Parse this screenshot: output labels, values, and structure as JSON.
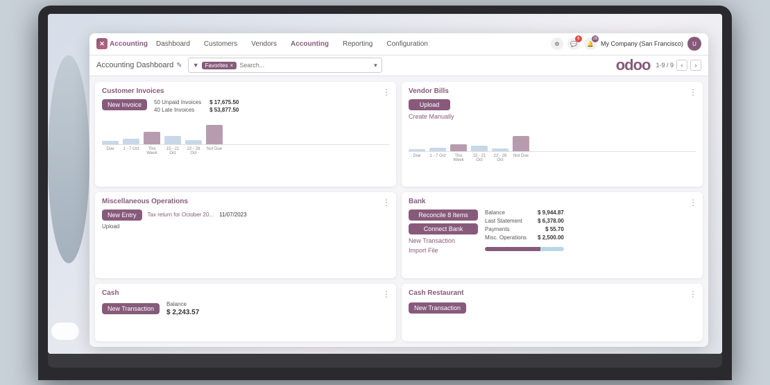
{
  "laptop": {
    "screen_bg": "#f0eff4"
  },
  "topbar": {
    "logo_text": "Accounting",
    "nav_items": [
      {
        "label": "Dashboard",
        "active": false
      },
      {
        "label": "Customers",
        "active": false
      },
      {
        "label": "Vendors",
        "active": false
      },
      {
        "label": "Accounting",
        "active": true
      },
      {
        "label": "Reporting",
        "active": false
      },
      {
        "label": "Configuration",
        "active": false
      }
    ],
    "notification_count_1": "6",
    "notification_count_2": "28",
    "company": "My Company (San Francisco)"
  },
  "toolbar": {
    "title": "Accounting Dashboard",
    "edit_icon": "✎",
    "search_filter": "Favorites",
    "search_placeholder": "Search...",
    "pagination": "1-9 / 9"
  },
  "customer_invoices": {
    "title": "Customer Invoices",
    "new_invoice_label": "New Invoice",
    "unpaid_count": "50 Unpaid Invoices",
    "late_count": "40 Late Invoices",
    "unpaid_amount": "$ 17,675.50",
    "late_amount": "$ 53,877.50",
    "chart_labels": [
      "Due",
      "1 - 7 Oct",
      "This Week",
      "15 - 21 Oct",
      "22 - 28 Oct",
      "Not Due"
    ],
    "chart_bars": [
      5,
      8,
      18,
      12,
      6,
      28
    ]
  },
  "vendor_bills": {
    "title": "Vendor Bills",
    "upload_label": "Upload",
    "create_manually_label": "Create Manually",
    "chart_labels": [
      "Due",
      "1 - 7 Oct",
      "This Week",
      "15 - 21 Oct",
      "22 - 28 Oct",
      "Not Due"
    ],
    "chart_bars": [
      3,
      5,
      10,
      8,
      4,
      22
    ]
  },
  "misc_operations": {
    "title": "Miscellaneous Operations",
    "new_entry_label": "New Entry",
    "upload_label": "Upload",
    "tax_return_label": "Tax return for October 20...",
    "date": "11/07/2023"
  },
  "bank": {
    "title": "Bank",
    "reconcile_label": "Reconcile 8 Items",
    "connect_bank_label": "Connect Bank",
    "new_transaction_label": "New Transaction",
    "import_file_label": "Import File",
    "balance_label": "Balance",
    "last_statement_label": "Last Statement",
    "payments_label": "Payments",
    "misc_operations_label": "Misc. Operations",
    "balance_amount": "$ 9,944.87",
    "last_statement_amount": "$ 6,378.00",
    "payments_amount": "$ 55.70",
    "misc_operations_amount": "$ 2,500.00"
  },
  "cash": {
    "title": "Cash",
    "new_transaction_label": "New Transaction",
    "balance_label": "Balance",
    "balance_amount": "$ 2,243.57"
  },
  "cash_restaurant": {
    "title": "Cash Restaurant",
    "new_transaction_label": "New Transaction"
  },
  "icons": {
    "menu_dots": "⋮",
    "chevron_left": "‹",
    "chevron_right": "›",
    "filter_icon": "▼",
    "search_icon": "🔍",
    "bell_icon": "🔔",
    "chat_icon": "💬",
    "settings_icon": "⚙"
  },
  "colors": {
    "brand_purple": "#875a7b",
    "accent_teal": "#5bc0de",
    "bar_light": "#c8d8e8",
    "bg_light": "#f5f5f8"
  }
}
